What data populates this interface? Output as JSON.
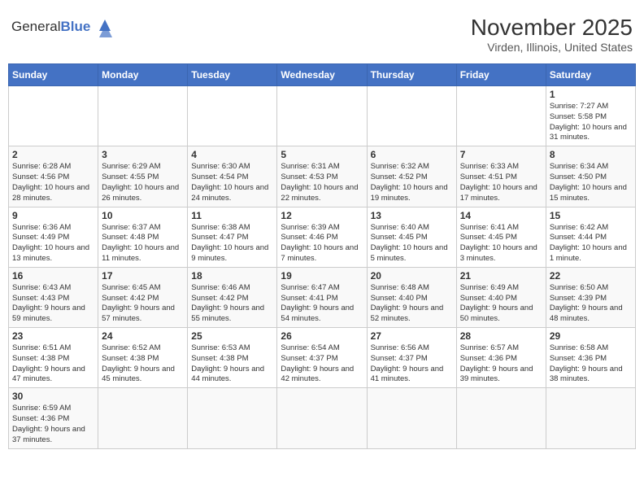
{
  "logo": {
    "text_normal": "General",
    "text_bold": "Blue"
  },
  "header": {
    "title": "November 2025",
    "subtitle": "Virden, Illinois, United States"
  },
  "weekdays": [
    "Sunday",
    "Monday",
    "Tuesday",
    "Wednesday",
    "Thursday",
    "Friday",
    "Saturday"
  ],
  "weeks": [
    [
      {
        "day": "",
        "info": ""
      },
      {
        "day": "",
        "info": ""
      },
      {
        "day": "",
        "info": ""
      },
      {
        "day": "",
        "info": ""
      },
      {
        "day": "",
        "info": ""
      },
      {
        "day": "",
        "info": ""
      },
      {
        "day": "1",
        "info": "Sunrise: 7:27 AM\nSunset: 5:58 PM\nDaylight: 10 hours and 31 minutes."
      }
    ],
    [
      {
        "day": "2",
        "info": "Sunrise: 6:28 AM\nSunset: 4:56 PM\nDaylight: 10 hours and 28 minutes."
      },
      {
        "day": "3",
        "info": "Sunrise: 6:29 AM\nSunset: 4:55 PM\nDaylight: 10 hours and 26 minutes."
      },
      {
        "day": "4",
        "info": "Sunrise: 6:30 AM\nSunset: 4:54 PM\nDaylight: 10 hours and 24 minutes."
      },
      {
        "day": "5",
        "info": "Sunrise: 6:31 AM\nSunset: 4:53 PM\nDaylight: 10 hours and 22 minutes."
      },
      {
        "day": "6",
        "info": "Sunrise: 6:32 AM\nSunset: 4:52 PM\nDaylight: 10 hours and 19 minutes."
      },
      {
        "day": "7",
        "info": "Sunrise: 6:33 AM\nSunset: 4:51 PM\nDaylight: 10 hours and 17 minutes."
      },
      {
        "day": "8",
        "info": "Sunrise: 6:34 AM\nSunset: 4:50 PM\nDaylight: 10 hours and 15 minutes."
      }
    ],
    [
      {
        "day": "9",
        "info": "Sunrise: 6:36 AM\nSunset: 4:49 PM\nDaylight: 10 hours and 13 minutes."
      },
      {
        "day": "10",
        "info": "Sunrise: 6:37 AM\nSunset: 4:48 PM\nDaylight: 10 hours and 11 minutes."
      },
      {
        "day": "11",
        "info": "Sunrise: 6:38 AM\nSunset: 4:47 PM\nDaylight: 10 hours and 9 minutes."
      },
      {
        "day": "12",
        "info": "Sunrise: 6:39 AM\nSunset: 4:46 PM\nDaylight: 10 hours and 7 minutes."
      },
      {
        "day": "13",
        "info": "Sunrise: 6:40 AM\nSunset: 4:45 PM\nDaylight: 10 hours and 5 minutes."
      },
      {
        "day": "14",
        "info": "Sunrise: 6:41 AM\nSunset: 4:45 PM\nDaylight: 10 hours and 3 minutes."
      },
      {
        "day": "15",
        "info": "Sunrise: 6:42 AM\nSunset: 4:44 PM\nDaylight: 10 hours and 1 minute."
      }
    ],
    [
      {
        "day": "16",
        "info": "Sunrise: 6:43 AM\nSunset: 4:43 PM\nDaylight: 9 hours and 59 minutes."
      },
      {
        "day": "17",
        "info": "Sunrise: 6:45 AM\nSunset: 4:42 PM\nDaylight: 9 hours and 57 minutes."
      },
      {
        "day": "18",
        "info": "Sunrise: 6:46 AM\nSunset: 4:42 PM\nDaylight: 9 hours and 55 minutes."
      },
      {
        "day": "19",
        "info": "Sunrise: 6:47 AM\nSunset: 4:41 PM\nDaylight: 9 hours and 54 minutes."
      },
      {
        "day": "20",
        "info": "Sunrise: 6:48 AM\nSunset: 4:40 PM\nDaylight: 9 hours and 52 minutes."
      },
      {
        "day": "21",
        "info": "Sunrise: 6:49 AM\nSunset: 4:40 PM\nDaylight: 9 hours and 50 minutes."
      },
      {
        "day": "22",
        "info": "Sunrise: 6:50 AM\nSunset: 4:39 PM\nDaylight: 9 hours and 48 minutes."
      }
    ],
    [
      {
        "day": "23",
        "info": "Sunrise: 6:51 AM\nSunset: 4:38 PM\nDaylight: 9 hours and 47 minutes."
      },
      {
        "day": "24",
        "info": "Sunrise: 6:52 AM\nSunset: 4:38 PM\nDaylight: 9 hours and 45 minutes."
      },
      {
        "day": "25",
        "info": "Sunrise: 6:53 AM\nSunset: 4:38 PM\nDaylight: 9 hours and 44 minutes."
      },
      {
        "day": "26",
        "info": "Sunrise: 6:54 AM\nSunset: 4:37 PM\nDaylight: 9 hours and 42 minutes."
      },
      {
        "day": "27",
        "info": "Sunrise: 6:56 AM\nSunset: 4:37 PM\nDaylight: 9 hours and 41 minutes."
      },
      {
        "day": "28",
        "info": "Sunrise: 6:57 AM\nSunset: 4:36 PM\nDaylight: 9 hours and 39 minutes."
      },
      {
        "day": "29",
        "info": "Sunrise: 6:58 AM\nSunset: 4:36 PM\nDaylight: 9 hours and 38 minutes."
      }
    ],
    [
      {
        "day": "30",
        "info": "Sunrise: 6:59 AM\nSunset: 4:36 PM\nDaylight: 9 hours and 37 minutes."
      },
      {
        "day": "",
        "info": ""
      },
      {
        "day": "",
        "info": ""
      },
      {
        "day": "",
        "info": ""
      },
      {
        "day": "",
        "info": ""
      },
      {
        "day": "",
        "info": ""
      },
      {
        "day": "",
        "info": ""
      }
    ]
  ]
}
